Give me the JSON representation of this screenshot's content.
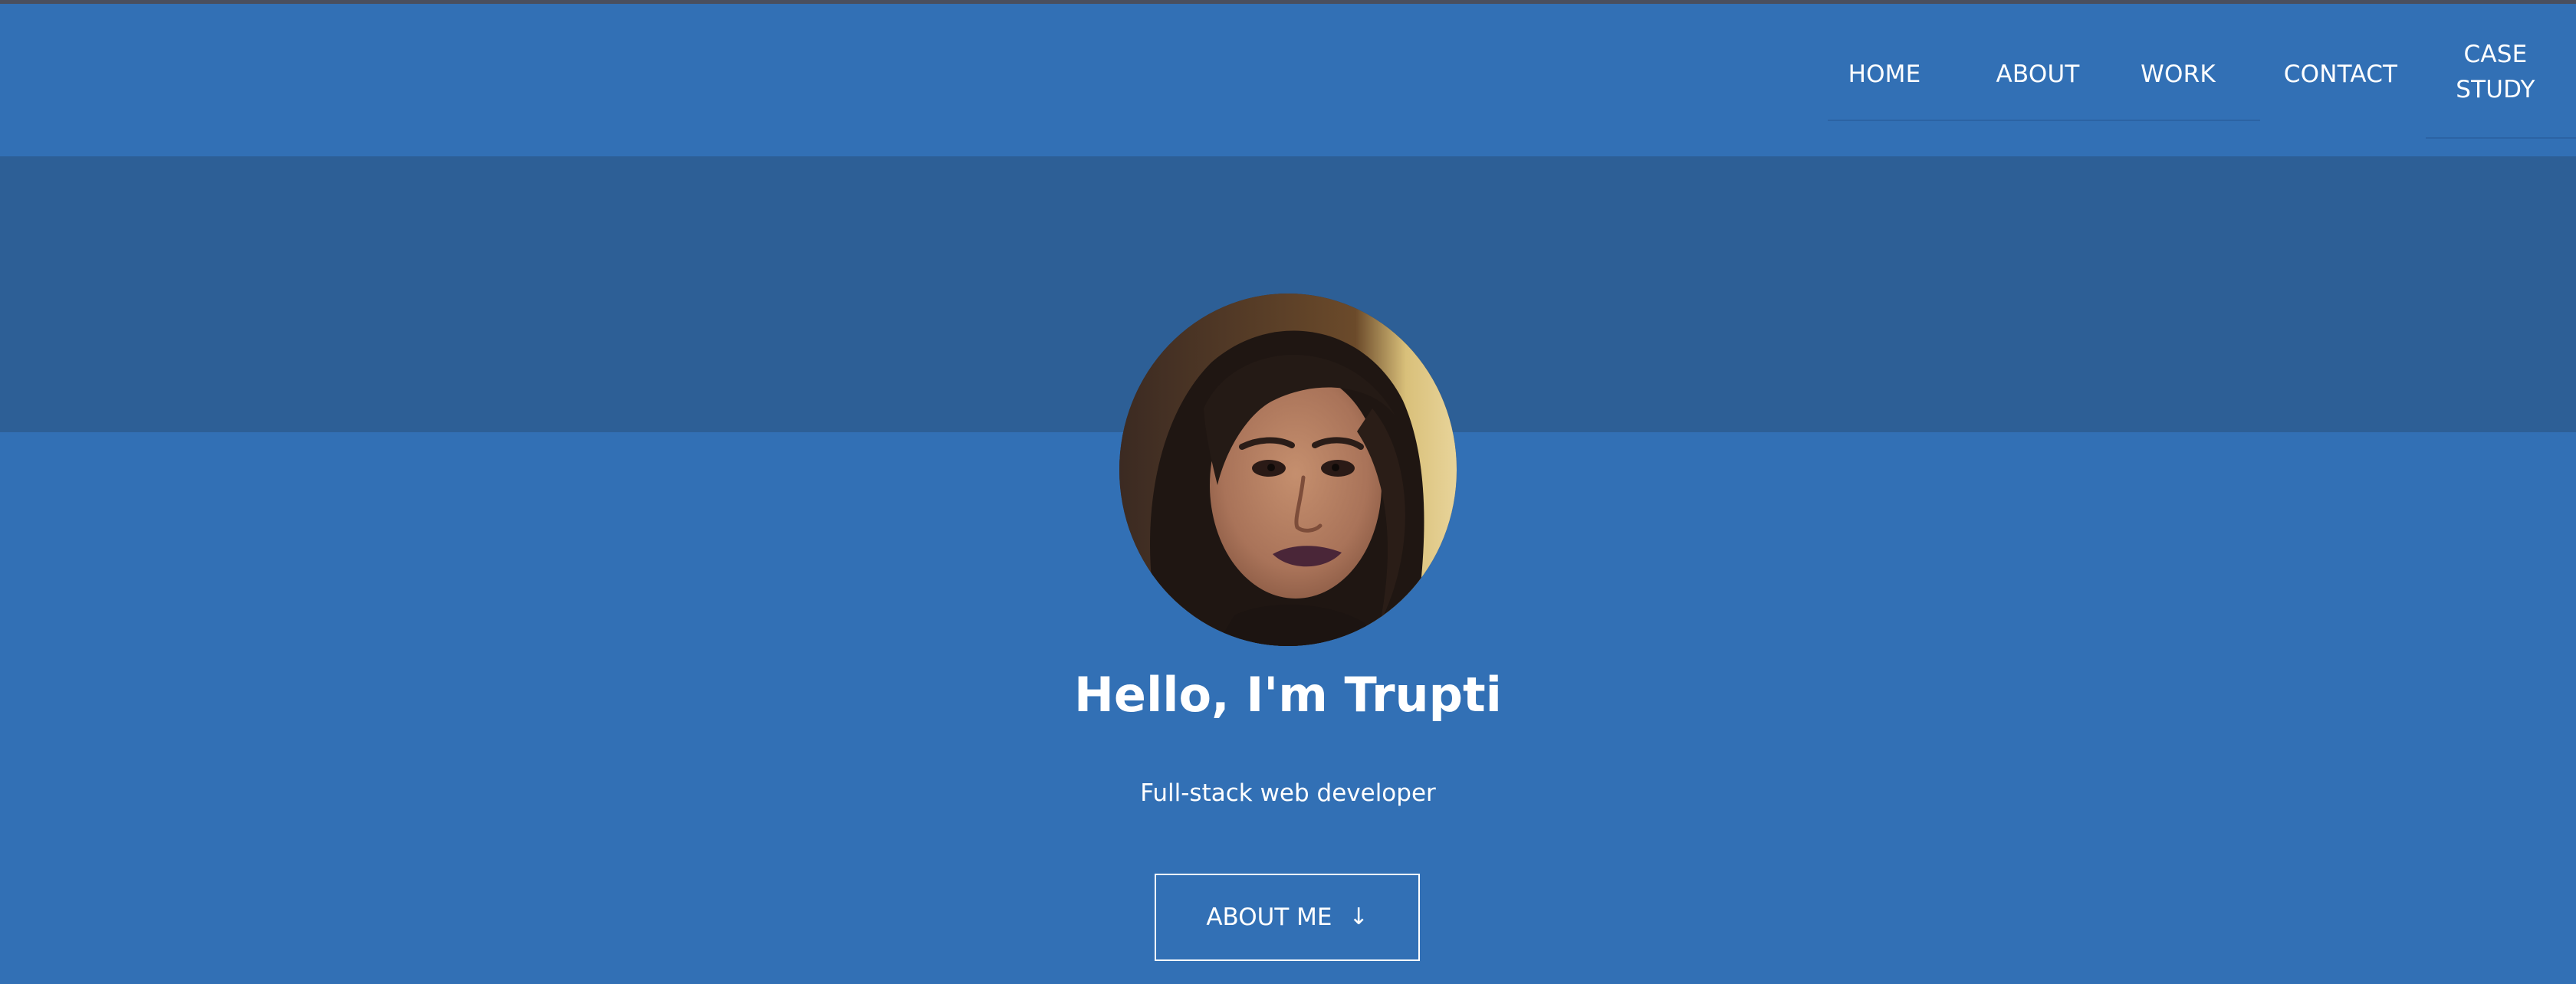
{
  "nav": {
    "items": [
      {
        "label": "HOME"
      },
      {
        "label": "ABOUT"
      },
      {
        "label": "WORK"
      },
      {
        "label": "CONTACT"
      },
      {
        "label": "CASE STUDY"
      }
    ]
  },
  "hero": {
    "avatar_icon": "profile-photo",
    "greeting": "Hello, I'm Trupti",
    "subtitle": "Full-stack web developer",
    "cta_label": "ABOUT ME",
    "cta_icon": "arrow-down-icon",
    "cta_arrow": "↓"
  },
  "colors": {
    "background": "#3270b5",
    "band": "#2d5f96",
    "text": "#ffffff"
  }
}
